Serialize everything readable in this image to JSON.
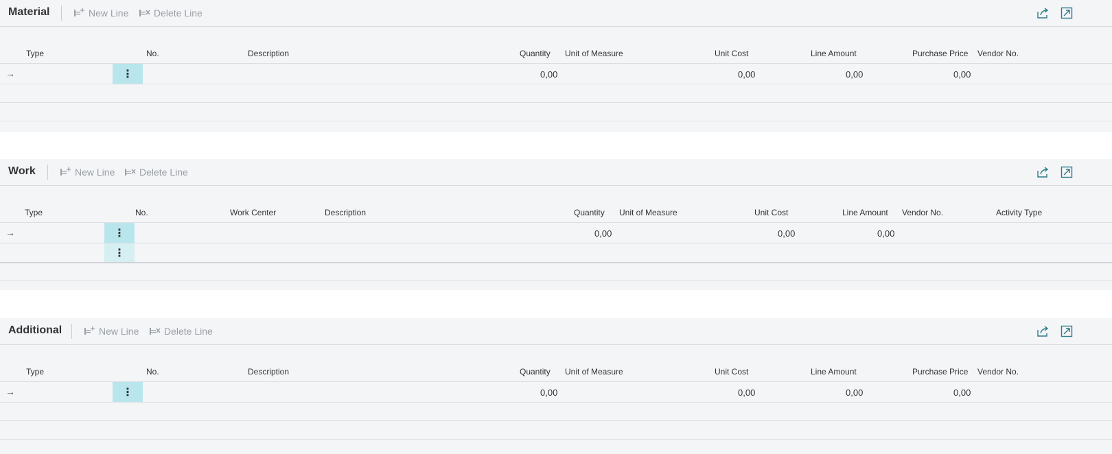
{
  "actions": {
    "new_line": "New Line",
    "delete_line": "Delete Line"
  },
  "material": {
    "title": "Material",
    "columns": {
      "type": "Type",
      "no": "No.",
      "description": "Description",
      "quantity": "Quantity",
      "uom": "Unit of Measure",
      "unit_cost": "Unit Cost",
      "line_amount": "Line Amount",
      "purchase_price": "Purchase Price",
      "vendor_no": "Vendor No."
    },
    "row": {
      "quantity": "0,00",
      "unit_cost": "0,00",
      "line_amount": "0,00",
      "purchase_price": "0,00"
    }
  },
  "work": {
    "title": "Work",
    "columns": {
      "type": "Type",
      "no": "No.",
      "work_center": "Work Center",
      "description": "Description",
      "quantity": "Quantity",
      "uom": "Unit of Measure",
      "unit_cost": "Unit Cost",
      "line_amount": "Line Amount",
      "vendor_no": "Vendor No.",
      "activity_type": "Activity Type"
    },
    "row": {
      "quantity": "0,00",
      "unit_cost": "0,00",
      "line_amount": "0,00"
    }
  },
  "additional": {
    "title": "Additional",
    "columns": {
      "type": "Type",
      "no": "No.",
      "description": "Description",
      "quantity": "Quantity",
      "uom": "Unit of Measure",
      "unit_cost": "Unit Cost",
      "line_amount": "Line Amount",
      "purchase_price": "Purchase Price",
      "vendor_no": "Vendor No."
    },
    "row": {
      "quantity": "0,00",
      "unit_cost": "0,00",
      "line_amount": "0,00",
      "purchase_price": "0,00"
    }
  },
  "icons": {
    "arrow": "→",
    "dots": "⋮"
  }
}
